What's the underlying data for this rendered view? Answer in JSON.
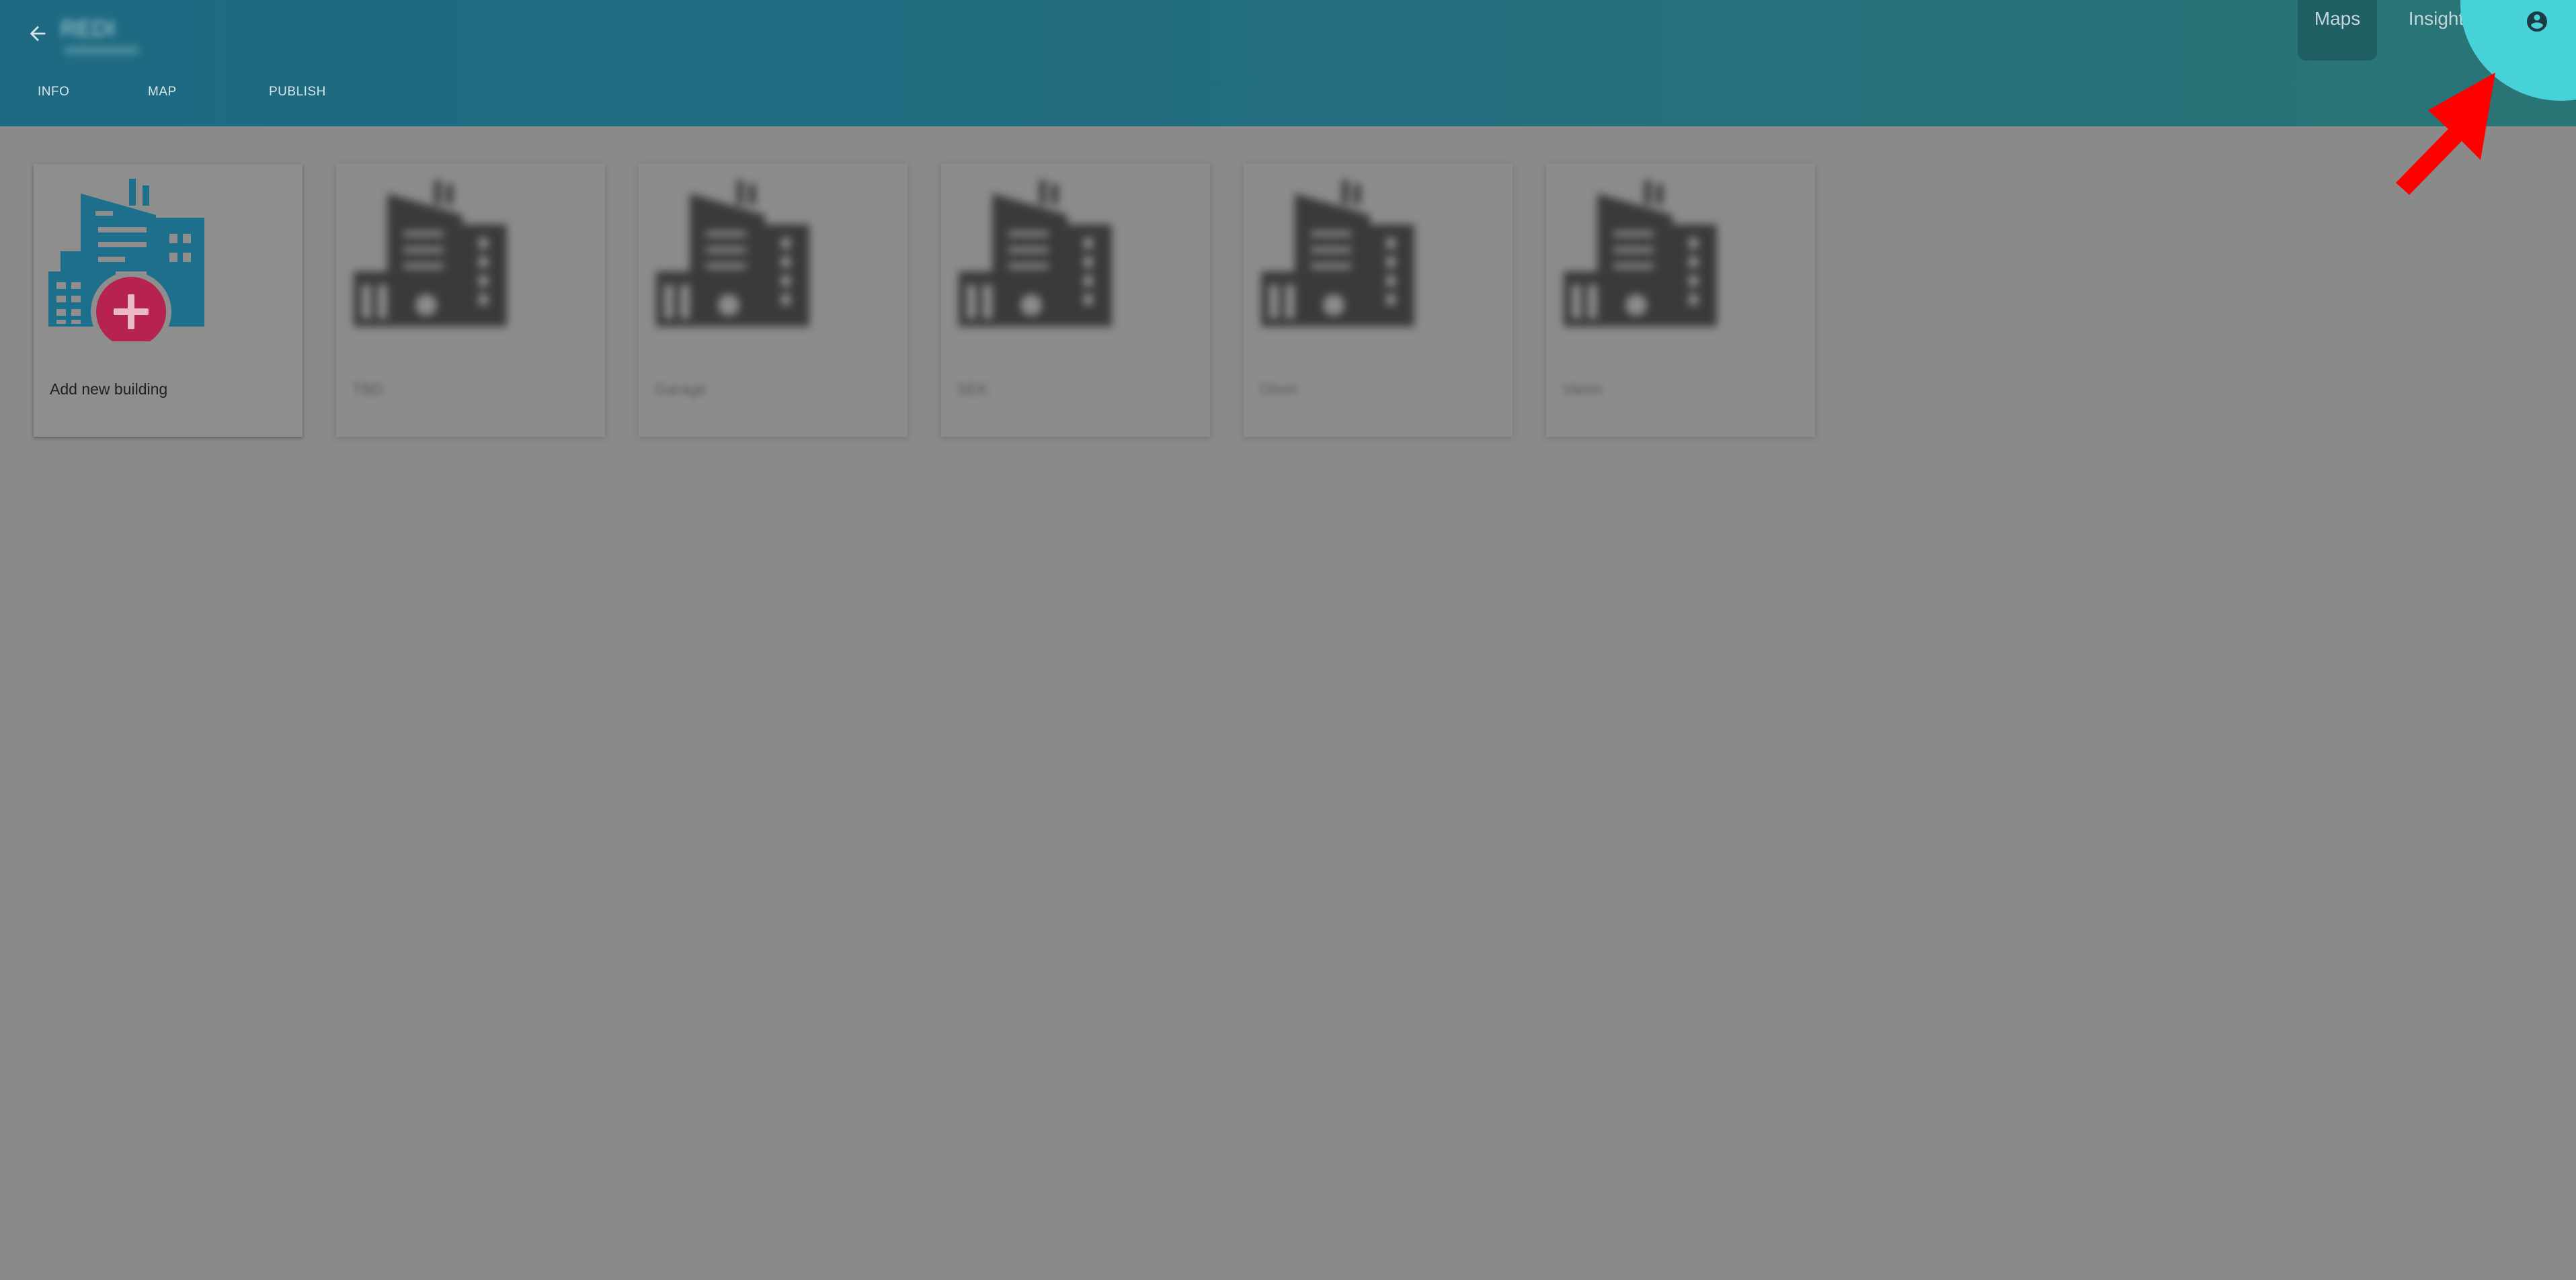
{
  "header": {
    "title": "REDI",
    "nav_tabs": [
      "INFO",
      "MAP",
      "PUBLISH"
    ],
    "top_tabs": {
      "maps": "Maps",
      "insights": "Insights"
    },
    "active_top_tab": "Maps"
  },
  "cards": {
    "add_label": "Add new building",
    "buildings": [
      "TBD",
      "Garage",
      "SEK",
      "Ghon",
      "Varen"
    ]
  },
  "colors": {
    "header_start": "#1d6a82",
    "header_end": "#2a7575",
    "accent_circle": "#47d2da",
    "building_icon": "#1e6f8c",
    "add_badge": "#b5234e",
    "pointer_arrow": "#ff0000",
    "page_background": "#8a8a8a"
  },
  "icons": {
    "back": "arrow-left-icon",
    "account": "account-circle-icon",
    "add_building": "building-add-icon",
    "building": "building-icon"
  }
}
